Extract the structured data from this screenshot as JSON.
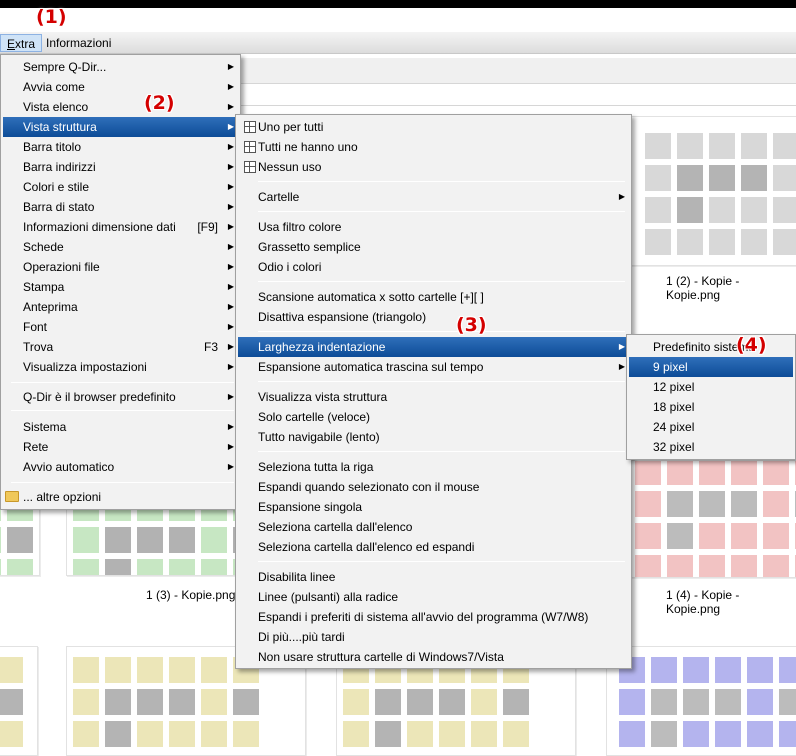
{
  "annotations": [
    "(1)",
    "(2)",
    "(3)",
    "(4)"
  ],
  "menubar": {
    "extra_prefix": "E",
    "extra_rest": "xtra",
    "info": "Informazioni"
  },
  "extra_menu": {
    "items": [
      {
        "label": "Sempre Q-Dir...",
        "submenu": true
      },
      {
        "label": "Avvia come",
        "submenu": true
      },
      {
        "label": "Vista elenco",
        "submenu": true
      },
      {
        "label": "Vista struttura",
        "submenu": true,
        "highlighted": true
      },
      {
        "label": "Barra titolo",
        "submenu": true
      },
      {
        "label": "Barra indirizzi",
        "submenu": true
      },
      {
        "label": "Colori e stile",
        "submenu": true
      },
      {
        "label": "Barra di stato",
        "submenu": true
      },
      {
        "label": "Informazioni dimensione dati",
        "shortcut": "[F9]",
        "submenu": true
      },
      {
        "label": "Schede",
        "submenu": true
      },
      {
        "label": "Operazioni file",
        "submenu": true
      },
      {
        "label": "Stampa",
        "submenu": true
      },
      {
        "label": "Anteprima",
        "submenu": true
      },
      {
        "label": "Font",
        "submenu": true
      },
      {
        "label": "Trova",
        "shortcut": "F3",
        "submenu": true
      },
      {
        "label": "Visualizza impostazioni",
        "submenu": true
      },
      {
        "label": "Q-Dir è il browser predefinito",
        "submenu": true
      },
      {
        "label": "Sistema",
        "submenu": true
      },
      {
        "label": "Rete",
        "submenu": true
      },
      {
        "label": "Avvio automatico",
        "submenu": true
      },
      {
        "label": "... altre opzioni",
        "icon": "folder-icon"
      }
    ]
  },
  "vista_struttura_menu": {
    "items": [
      {
        "label": "Uno per tutti",
        "icon": "grid-icon"
      },
      {
        "label": "Tutti ne hanno uno",
        "icon": "grid-icon"
      },
      {
        "label": "Nessun uso",
        "icon": "grid-icon"
      },
      {
        "label": "Cartelle",
        "submenu": true
      },
      {
        "label": "Usa filtro colore"
      },
      {
        "label": "Grassetto semplice"
      },
      {
        "label": "Odio i colori"
      },
      {
        "label": "Scansione automatica x sotto cartelle [+][ ]"
      },
      {
        "label": "Disattiva espansione (triangolo)"
      },
      {
        "label": "Larghezza indentazione",
        "submenu": true,
        "highlighted": true
      },
      {
        "label": "Espansione automatica trascina sul tempo",
        "submenu": true
      },
      {
        "label": "Visualizza vista struttura"
      },
      {
        "label": "Solo cartelle (veloce)"
      },
      {
        "label": "Tutto navigabile (lento)"
      },
      {
        "label": "Seleziona tutta la riga"
      },
      {
        "label": "Espandi quando selezionato con il mouse"
      },
      {
        "label": "Espansione singola"
      },
      {
        "label": "Seleziona cartella dall'elenco"
      },
      {
        "label": "Seleziona cartella dall'elenco ed espandi"
      },
      {
        "label": "Disabilita linee"
      },
      {
        "label": "Linee (pulsanti) alla radice"
      },
      {
        "label": "Espandi i preferiti di sistema all'avvio del programma (W7/W8)"
      },
      {
        "label": "Di più....più tardi"
      },
      {
        "label": "Non usare struttura cartelle di Windows7/Vista"
      }
    ]
  },
  "indentazione_menu": {
    "items": [
      {
        "label": "Predefinito sistema"
      },
      {
        "label": "9 pixel",
        "highlighted": true
      },
      {
        "label": "12 pixel"
      },
      {
        "label": "18 pixel"
      },
      {
        "label": "24 pixel"
      },
      {
        "label": "32 pixel"
      }
    ]
  },
  "thumbnails": {
    "captions": [
      "1 (2) - Kopie - Kopie.png",
      "1 (3) - Kopie.png",
      "1 (4) - Kopie - Kopie.png"
    ],
    "colors": {
      "gray_light": "#d8d8d8",
      "gray_dark": "#b4b4b4",
      "green_light": "#c7e7c3",
      "green_dark": "#b2b2b2",
      "red_light": "#f2c3c3",
      "red_dark": "#bcbcbc",
      "yellow_light": "#ece6b8",
      "yellow_dark": "#b4b4b4",
      "blue_light": "#b4b4ee",
      "blue_dark": "#bcbcbc"
    }
  }
}
